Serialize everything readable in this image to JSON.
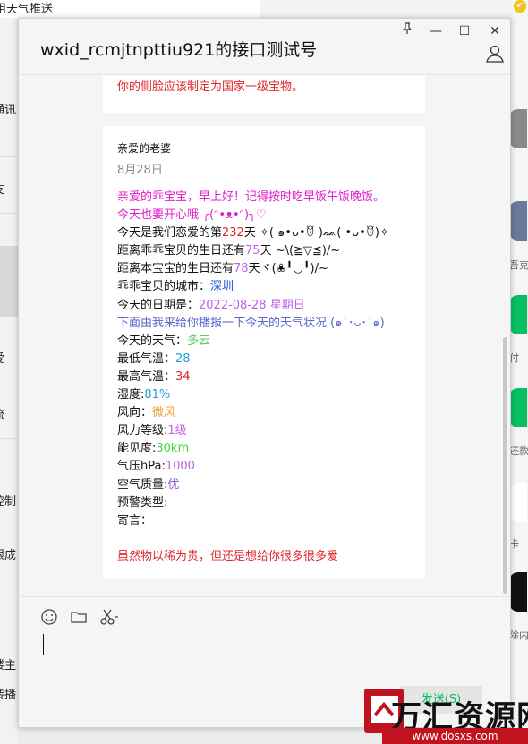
{
  "background": {
    "tab_title": "用天气推送",
    "left_items": [
      "通讯",
      "友",
      "爱—",
      "流",
      "控制",
      "眼成",
      "楼主",
      "转播"
    ],
    "right_items": [
      "吾克",
      "付",
      "还款",
      "卡",
      "除内"
    ]
  },
  "window": {
    "title": "wxid_rcmjtnpttiu921的接口测试号",
    "pin_label": "pin",
    "min_label": "—",
    "max_label": "☐",
    "close_label": "✕"
  },
  "chat": {
    "prev_message": "你的侧脸应该制定为国家一级宝物。",
    "card": {
      "heading": "亲爱的老婆",
      "date": "8月28日",
      "greeting_line1": "亲爱的乖宝宝，早上好！记得按时吃早饭午饭晚饭。",
      "greeting_line2": "今天也要开心哦 ╭(ᵔ•ᴥ•ᵔ)╮♡",
      "love_prefix": "今天是我们恋爱的第",
      "love_days": "232",
      "love_suffix": "天  ✧( ๑•ᴗ•ꆤ )ᨐ( •ᴗ•ꆤ)✧",
      "bday1_prefix": "距离乖乖宝贝的生日还有",
      "bday1_days": "75",
      "bday1_suffix": "天   ~\\(≧▽≦)/~",
      "bday2_prefix": "距离本宝宝的生日还有",
      "bday2_days": "78",
      "bday2_suffix": "天ヾ(❀╹◡╹)/~",
      "city_label": "乖乖宝贝的城市：",
      "city": "深圳",
      "date_label": "今天的日期是：",
      "date_value": "2022-08-28  星期日",
      "report_line": "下面由我来给你播报一下今天的天气状况  (๑`･ᴗ･´๑)",
      "weather_label": "今天的天气：",
      "weather": "多云",
      "low_label": "最低气温：",
      "low": "28",
      "high_label": "最高气温：",
      "high": "34",
      "humidity_label": "湿度:",
      "humidity": "81%",
      "wind_label": "风向：",
      "wind": "微风",
      "wind_level_label": "风力等级:",
      "wind_level": "1级",
      "visibility_label": "能见度:",
      "visibility": "30km",
      "pressure_label": "气压hPa:",
      "pressure": "1000",
      "air_label": "空气质量:",
      "air": "优",
      "alert_label": "预警类型:",
      "alert": "",
      "message_label": "寄言：",
      "message": "",
      "closing": "虽然物以稀为贵，但还是想给你很多很多爱"
    }
  },
  "toolbar": {
    "emoji_icon": "smile-icon",
    "folder_icon": "folder-icon",
    "scissors_icon": "scissors-icon"
  },
  "send_label": "发送(S)",
  "watermark": {
    "name": "万汇资源网",
    "url": "www.dosxs.com"
  },
  "colors": {
    "pink": "#e01fcb",
    "red": "#e0262b",
    "purple": "#c060e8",
    "blue": "#1f4fd8",
    "slate": "#5a67c8",
    "green": "#5ac85a",
    "teal": "#27a1d8",
    "orange": "#f0a030",
    "brightgreen": "#3dd83d",
    "violet": "#8a5ad8",
    "accent": "#07c160"
  }
}
